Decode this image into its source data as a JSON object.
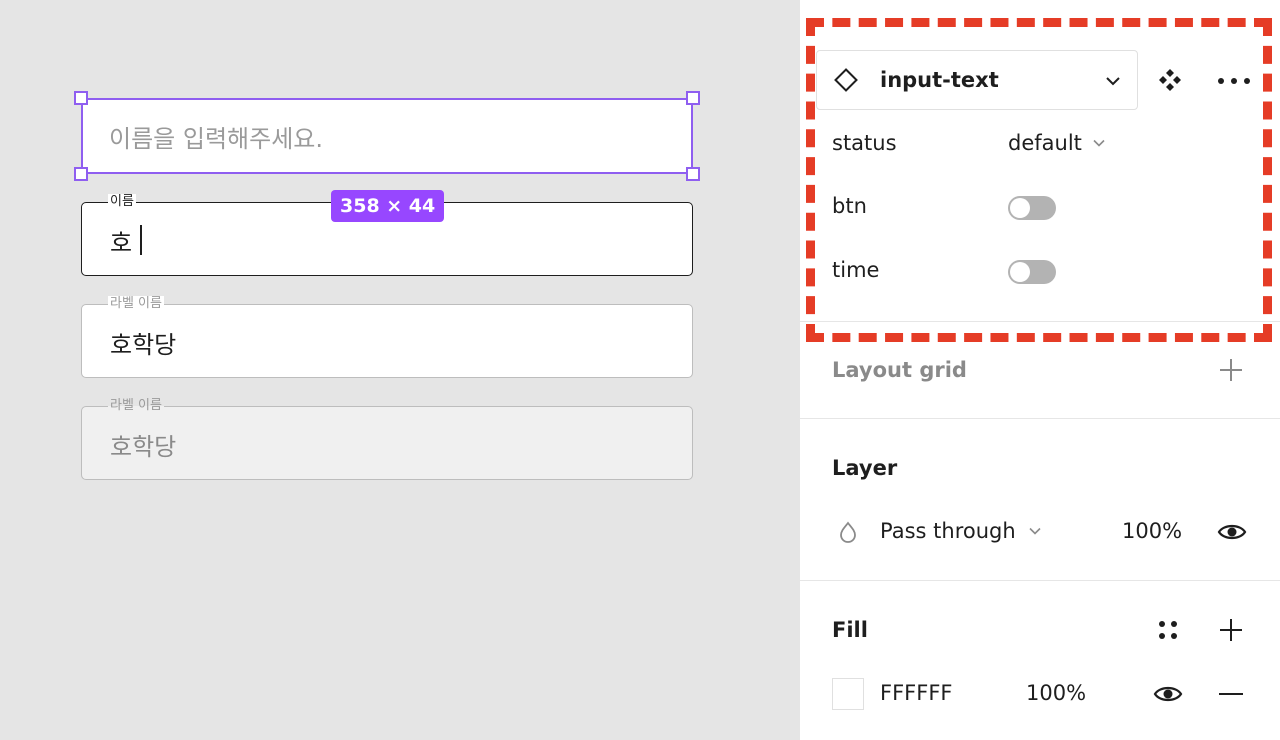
{
  "canvas": {
    "fields": {
      "placeholder": {
        "placeholder": "이름을 입력해주세요."
      },
      "typing": {
        "label": "이름",
        "value": "호"
      },
      "filled": {
        "label": "라벨 이름",
        "value": "호학당"
      },
      "disabled": {
        "label": "라벨 이름",
        "value": "호학당"
      }
    },
    "selection": {
      "size_badge": "358 × 44",
      "color": "#8f5ef0",
      "badge_color": "#9747ff"
    }
  },
  "panel": {
    "component": {
      "icon": "component-diamond-icon",
      "name": "input-text"
    },
    "properties": [
      {
        "label": "status",
        "type": "select",
        "value": "default"
      },
      {
        "label": "btn",
        "type": "toggle",
        "on": false
      },
      {
        "label": "time",
        "type": "toggle",
        "on": false
      }
    ],
    "layout_grid": {
      "title": "Layout grid"
    },
    "layer": {
      "title": "Layer",
      "blend_mode": "Pass through",
      "opacity": "100%"
    },
    "fill": {
      "title": "Fill",
      "color_hex": "FFFFFF",
      "opacity": "100%"
    }
  },
  "colors": {
    "highlight": "#e53c26",
    "canvas_bg": "#e5e5e5"
  }
}
